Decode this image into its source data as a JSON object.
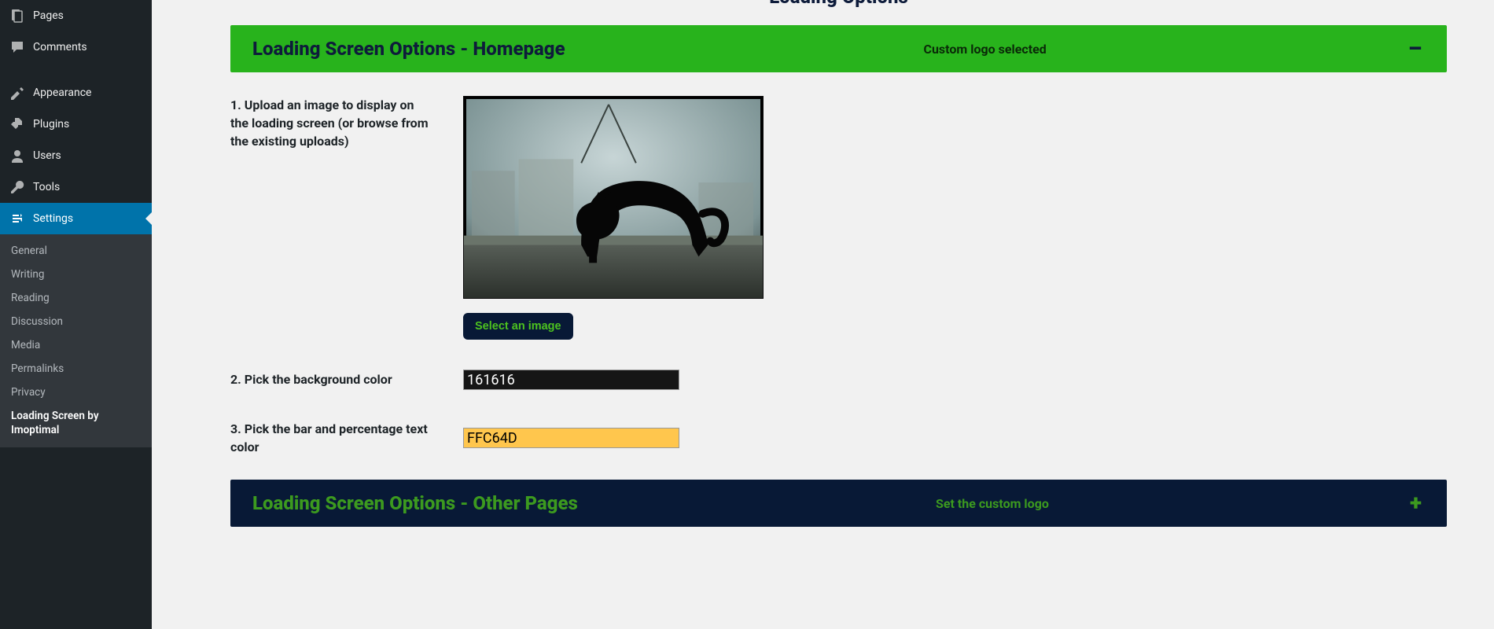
{
  "sidebar": {
    "items": [
      {
        "label": "Pages",
        "icon": "pages"
      },
      {
        "label": "Comments",
        "icon": "comments"
      },
      {
        "label": "Appearance",
        "icon": "appearance"
      },
      {
        "label": "Plugins",
        "icon": "plugins"
      },
      {
        "label": "Users",
        "icon": "users"
      },
      {
        "label": "Tools",
        "icon": "tools"
      },
      {
        "label": "Settings",
        "icon": "settings"
      }
    ],
    "sub": [
      "General",
      "Writing",
      "Reading",
      "Discussion",
      "Media",
      "Permalinks",
      "Privacy",
      "Loading Screen by Imoptimal"
    ]
  },
  "page_heading": "Loading Options",
  "panel_home": {
    "title": "Loading Screen Options - Homepage",
    "status": "Custom logo selected",
    "toggle": "–",
    "field1_label": "1. Upload an image to display on the loading screen (or browse from the existing uploads)",
    "select_btn": "Select an image",
    "field2_label": "2. Pick the background color",
    "bg_value": "161616",
    "field3_label": "3. Pick the bar and percentage text color",
    "bar_value": "FFC64D"
  },
  "panel_other": {
    "title": "Loading Screen Options - Other Pages",
    "status": "Set the custom logo",
    "toggle": "+"
  }
}
